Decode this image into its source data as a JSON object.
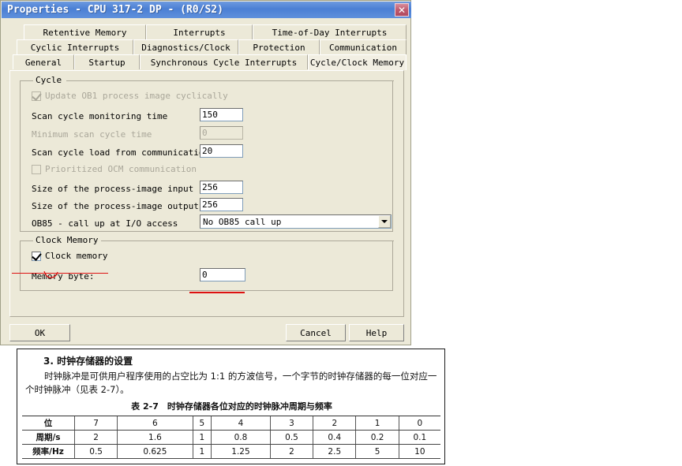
{
  "dialog": {
    "title": "Properties - CPU 317-2 DP - (R0/S2)",
    "close_label": "✕",
    "tabs_row1": [
      {
        "label": "Retentive Memory"
      },
      {
        "label": "Interrupts"
      },
      {
        "label": "Time-of-Day Interrupts"
      }
    ],
    "tabs_row2": [
      {
        "label": "Cyclic Interrupts"
      },
      {
        "label": "Diagnostics/Clock"
      },
      {
        "label": "Protection"
      },
      {
        "label": "Communication"
      }
    ],
    "tabs_row3": [
      {
        "label": "General"
      },
      {
        "label": "Startup"
      },
      {
        "label": "Synchronous Cycle Interrupts"
      },
      {
        "label": "Cycle/Clock Memory"
      }
    ],
    "active_tab": "Cycle/Clock Memory",
    "cycle_group": {
      "legend": "Cycle",
      "update_ob1_checkbox": "Update OB1 process image cyclically",
      "scan_cycle_monitoring_label": "Scan cycle monitoring time",
      "scan_cycle_monitoring_value": "150",
      "minimum_scan_cycle_label": "Minimum scan cycle time",
      "minimum_scan_cycle_value": "0",
      "scan_cycle_load_label": "Scan cycle load from communication",
      "scan_cycle_load_value": "20",
      "prioritized_ocm_checkbox": "Prioritized OCM communication",
      "process_image_input_label": "Size of the process-image input",
      "process_image_input_value": "256",
      "process_image_output_label": "Size of the process-image output",
      "process_image_output_value": "256",
      "ob85_label": "OB85 - call up at I/O access",
      "ob85_value": "No OB85 call up"
    },
    "clock_group": {
      "legend": "Clock Memory",
      "clock_memory_checkbox": "Clock memory",
      "memory_byte_label": "Memory byte:",
      "memory_byte_value": "0"
    },
    "buttons": {
      "ok": "OK",
      "cancel": "Cancel",
      "help": "Help"
    },
    "colors": {
      "titlebar": "#4b7fd4",
      "face": "#ece9d8",
      "annotation": "#dd1111"
    }
  },
  "document": {
    "heading": "3.  时钟存储器的设置",
    "paragraph": "时钟脉冲是可供用户程序使用的占空比为 1:1 的方波信号，一个字节的时钟存储器的每一位对应一个时钟脉冲（见表 2-7）。",
    "table_caption": "表 2-7　时钟存储器各位对应的时钟脉冲周期与频率",
    "table": {
      "rows": [
        {
          "header": "位",
          "cells": [
            "7",
            "6",
            "5",
            "4",
            "3",
            "2",
            "1",
            "0"
          ]
        },
        {
          "header": "周期/s",
          "cells": [
            "2",
            "1.6",
            "1",
            "0.8",
            "0.5",
            "0.4",
            "0.2",
            "0.1"
          ]
        },
        {
          "header": "频率/Hz",
          "cells": [
            "0.5",
            "0.625",
            "1",
            "1.25",
            "2",
            "2.5",
            "5",
            "10"
          ]
        }
      ]
    }
  }
}
